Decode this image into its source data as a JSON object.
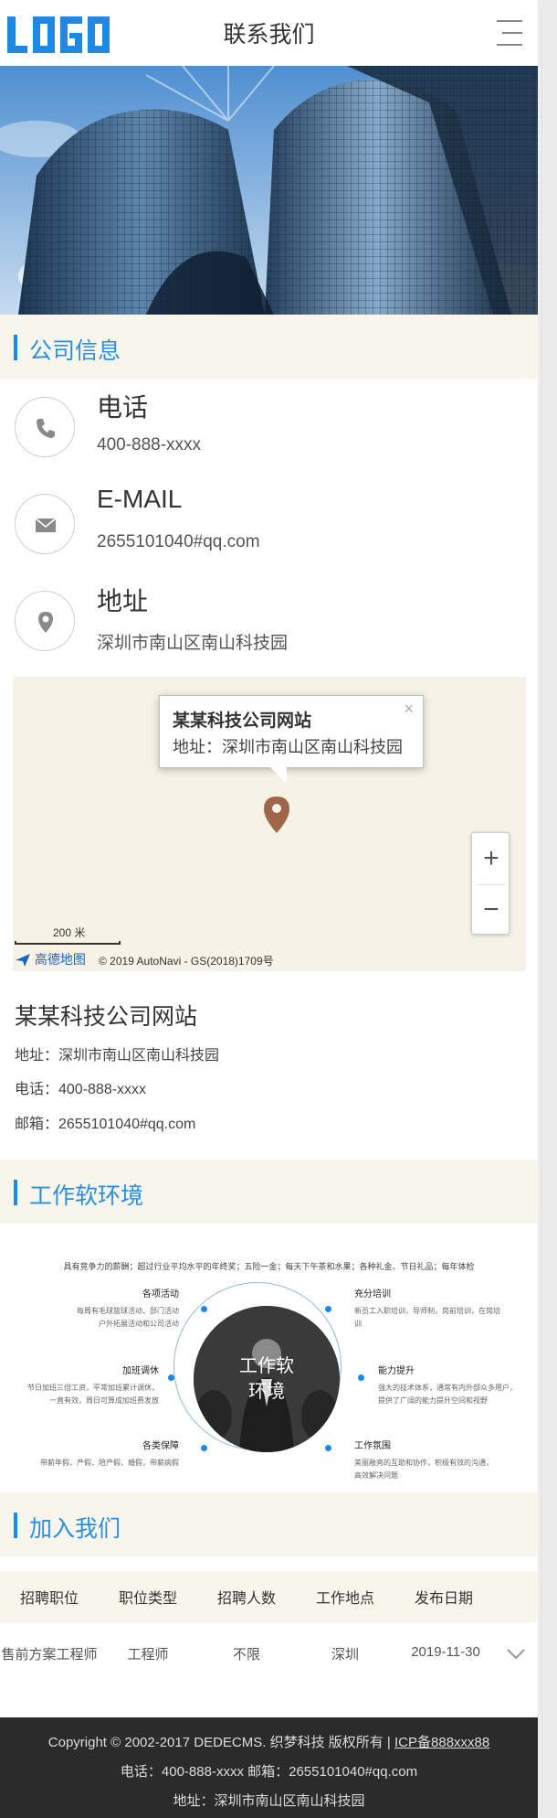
{
  "header": {
    "logo_text": "LOGO",
    "title": "联系我们",
    "menu_icon": "hamburger-icon"
  },
  "company_section": {
    "title": "公司信息",
    "contacts": [
      {
        "icon": "phone-icon",
        "label": "电话",
        "value": "400-888-xxxx"
      },
      {
        "icon": "mail-icon",
        "label": "E-MAIL",
        "value": "2655101040#qq.com"
      },
      {
        "icon": "location-icon",
        "label": "地址",
        "value": "深圳市南山区南山科技园"
      }
    ]
  },
  "map": {
    "popup_title": "某某科技公司网站",
    "popup_address": "地址：深圳市南山区南山科技园",
    "close_symbol": "×",
    "zoom_in": "+",
    "zoom_out": "−",
    "scale": "200 米",
    "brand": "高德地图",
    "copyright": "© 2019 AutoNavi - GS(2018)1709号"
  },
  "company_info": {
    "name": "某某科技公司网站",
    "address": "地址：深圳市南山区南山科技园",
    "phone": "电话：400-888-xxxx",
    "email": "邮箱：2655101040#qq.com"
  },
  "environment": {
    "title": "工作软环境",
    "top_note": "具有竞争力的薪酬；超过行业平均水平的年终奖；五险一金；每天下午茶和水果；各种礼金、节日礼品；每年体检",
    "center_label_1": "工作软",
    "center_label_2": "环境",
    "items": [
      {
        "title": "各项活动",
        "desc": "每周有毛球篮球活动、部门活动\n户外拓展活动和公司活动"
      },
      {
        "title": "充分培训",
        "desc": "新员工入职培训，导师制，岗前培训，在岗培训"
      },
      {
        "title": "加班调休",
        "desc": "节日加班三倍工资，平常加班累计调休，\n一直有效，周日可算成加班费发放"
      },
      {
        "title": "能力提升",
        "desc": "强大的技术体系，通常有内外部众多用户，\n提供了广阔的能力提升空间和视野"
      },
      {
        "title": "各类保障",
        "desc": "带薪年假、产假、陪产假、婚假，带薪病假"
      },
      {
        "title": "工作氛围",
        "desc": "美丽敞亮的互助和协作，积极有效的沟通，\n高效解决问题"
      }
    ]
  },
  "jobs": {
    "title": "加入我们",
    "headers": [
      "招聘职位",
      "职位类型",
      "招聘人数",
      "工作地点",
      "发布日期"
    ],
    "rows": [
      {
        "position": "售前方案工程师",
        "type": "工程师",
        "count": "不限",
        "location": "深圳",
        "date": "2019-11-30"
      }
    ],
    "expand_icon": "chevron-down-icon"
  },
  "footer": {
    "copyright": "Copyright © 2002-2017 DEDECMS. 织梦科技 版权所有 |",
    "icp": "ICP备888xxx88",
    "contact_line": "电话：400-888-xxxx    邮箱：2655101040#qq.com",
    "address": "地址：深圳市南山区南山科技园"
  }
}
